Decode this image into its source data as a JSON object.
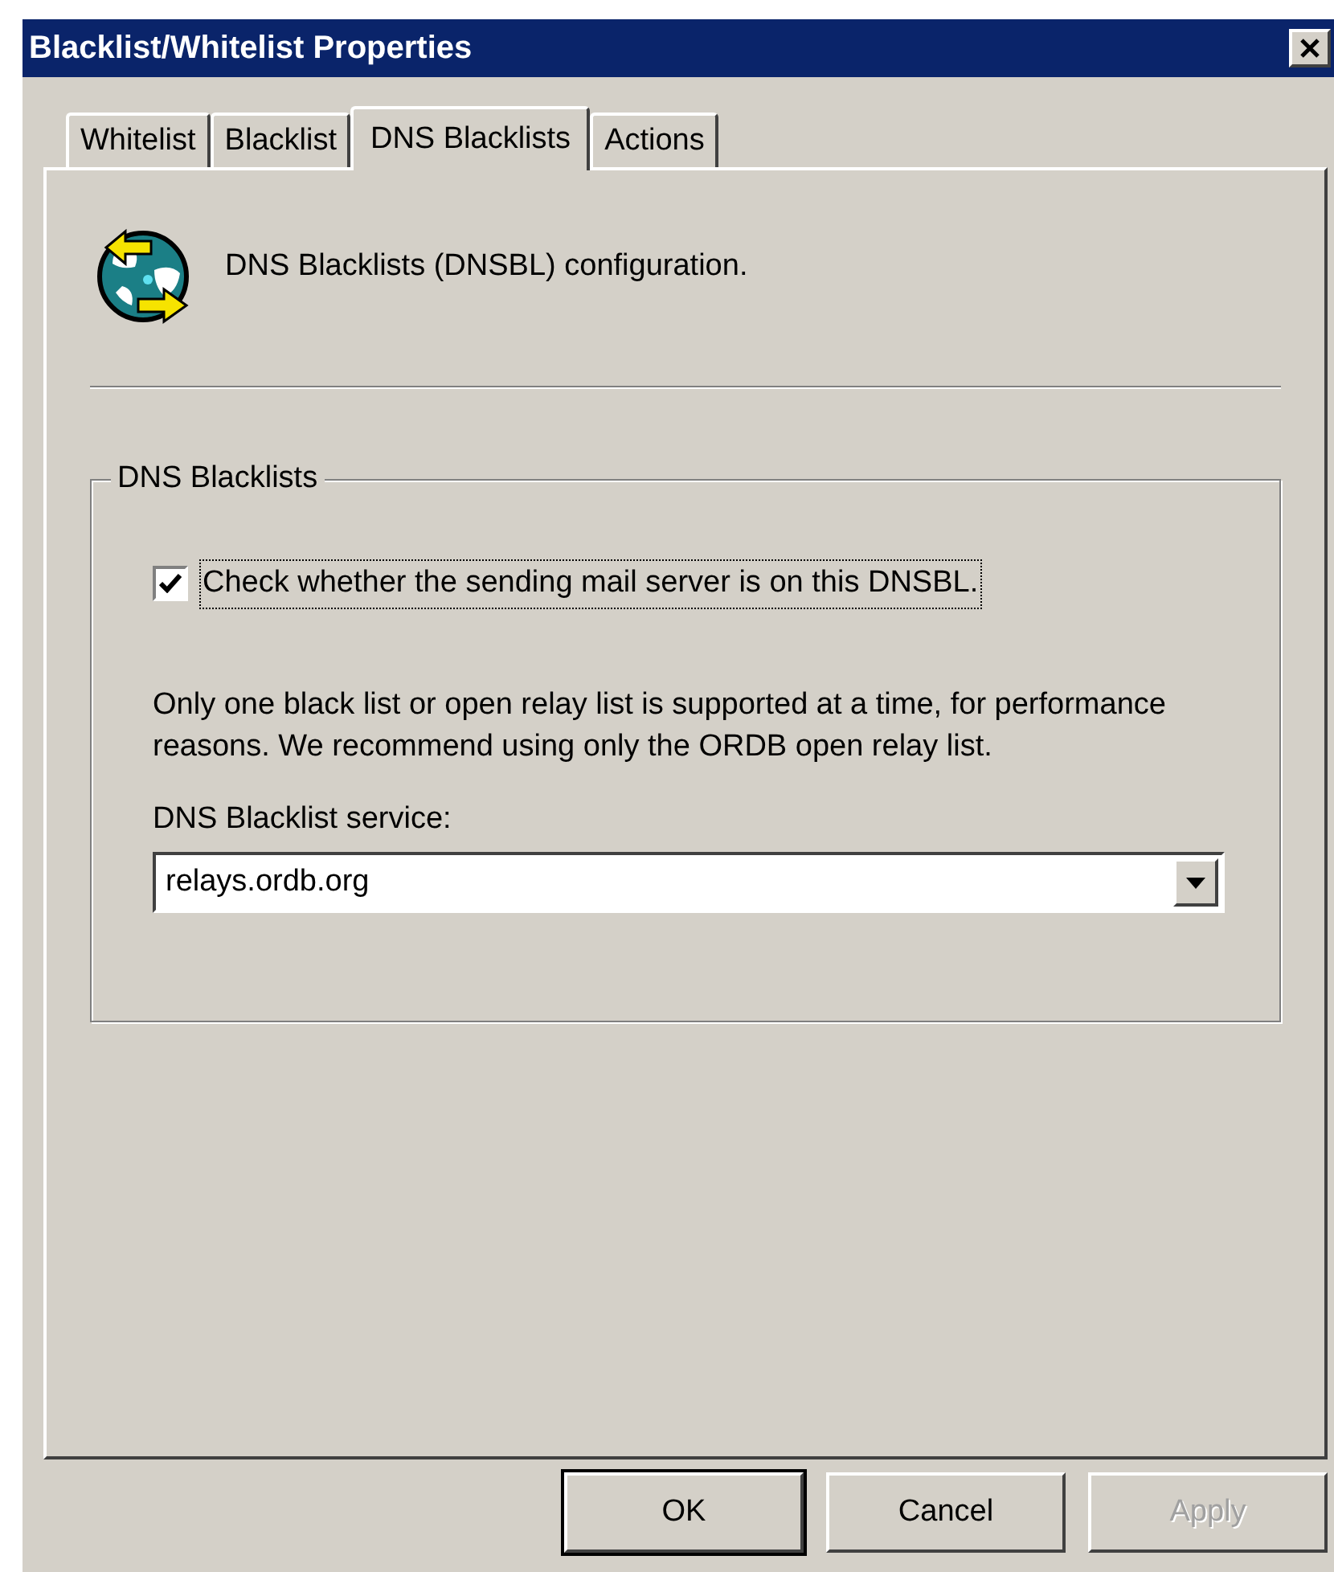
{
  "window": {
    "title": "Blacklist/Whitelist Properties"
  },
  "tabs": [
    {
      "label": "Whitelist",
      "selected": false
    },
    {
      "label": "Blacklist",
      "selected": false
    },
    {
      "label": "DNS Blacklists",
      "selected": true
    },
    {
      "label": "Actions",
      "selected": false
    }
  ],
  "header": {
    "text": "DNS Blacklists (DNSBL) configuration."
  },
  "group": {
    "title": "DNS Blacklists",
    "checkbox": {
      "label": "Check whether the sending mail server is on this DNSBL.",
      "checked": true,
      "focused": true
    },
    "note": "Only one black list or open relay list is supported at a time, for performance reasons. We recommend using only the ORDB open relay list.",
    "service": {
      "label": "DNS Blacklist service:",
      "value": "relays.ordb.org"
    }
  },
  "buttons": [
    {
      "label": "OK",
      "default": true,
      "disabled": false
    },
    {
      "label": "Cancel",
      "default": false,
      "disabled": false
    },
    {
      "label": "Apply",
      "default": false,
      "disabled": true
    }
  ]
}
